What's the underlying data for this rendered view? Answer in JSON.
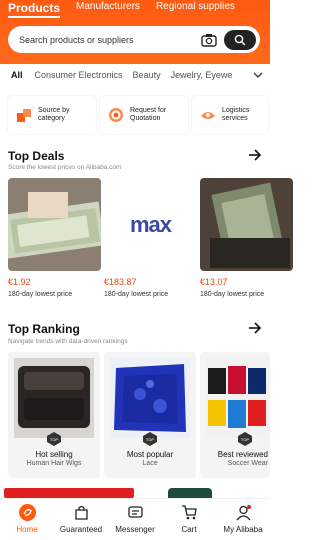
{
  "header": {
    "tabs": [
      {
        "label": "Products"
      },
      {
        "label": "Manufacturers"
      },
      {
        "label": "Regional supplies"
      }
    ],
    "search_placeholder": "Search products or suppliers"
  },
  "categories": [
    "All",
    "Consumer Electronics",
    "Beauty",
    "Jewelry, Eyewe"
  ],
  "quick_links": [
    {
      "label": "Source by category",
      "icon": "source-category-icon"
    },
    {
      "label": "Request for Quotation",
      "icon": "rfq-target-icon"
    },
    {
      "label": "Logistics services",
      "icon": "logistics-icon"
    }
  ],
  "top_deals": {
    "title": "Top Deals",
    "subtitle": "Score the lowest prices on Alibaba.com",
    "items": [
      {
        "price": "€1.92",
        "note": "180-day lowest price"
      },
      {
        "price": "€183.87",
        "note": "180-day lowest price",
        "logo_text": "max"
      },
      {
        "price": "€13.07",
        "note": "180-day lowest price"
      }
    ]
  },
  "top_ranking": {
    "title": "Top Ranking",
    "subtitle": "Navigate trends with data-driven rankings",
    "badge_text": "TOP",
    "items": [
      {
        "title": "Hot selling",
        "sub": "Human Hair Wigs"
      },
      {
        "title": "Most popular",
        "sub": "Lace"
      },
      {
        "title": "Best reviewed",
        "sub": "Soccer Wear"
      }
    ]
  },
  "nav": [
    {
      "label": "Home",
      "icon": "home-icon",
      "active": true
    },
    {
      "label": "Guaranteed",
      "icon": "guaranteed-icon"
    },
    {
      "label": "Messenger",
      "icon": "messenger-icon"
    },
    {
      "label": "Cart",
      "icon": "cart-icon"
    },
    {
      "label": "My Alibaba",
      "icon": "profile-icon"
    }
  ],
  "colors": {
    "brand": "#ff5a12",
    "price": "#e64a19"
  }
}
